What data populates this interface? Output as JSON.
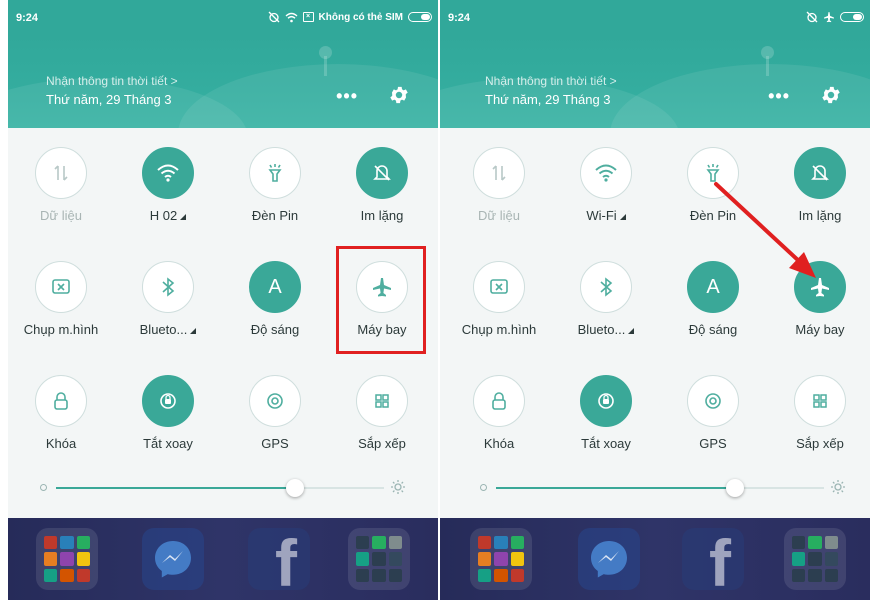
{
  "colors": {
    "accent": "#3aa898",
    "header": "#31a89a",
    "annotation_red": "#e02020"
  },
  "panels": [
    {
      "status": {
        "time": "9:24",
        "carrier": "Không có thẻ SIM"
      },
      "header": {
        "weather_link": "Nhận thông tin thời tiết >",
        "date": "Thứ năm, 29 Tháng 3"
      },
      "tiles": {
        "data": {
          "label": "Dữ liệu",
          "icon": "data-arrows-icon",
          "on": false
        },
        "wifi": {
          "label": "H 02",
          "icon": "wifi-icon",
          "on": true
        },
        "flashlight": {
          "label": "Đèn Pin",
          "icon": "flashlight-icon",
          "on": false
        },
        "silent": {
          "label": "Im lặng",
          "icon": "bell-off-icon",
          "on": true
        },
        "screenshot": {
          "label": "Chụp m.hình",
          "icon": "screenshot-icon",
          "on": false
        },
        "bluetooth": {
          "label": "Blueto...",
          "icon": "bluetooth-icon",
          "on": false
        },
        "brightness": {
          "label": "Độ sáng",
          "icon": "auto-brightness-icon",
          "glyph": "A",
          "on": true
        },
        "airplane": {
          "label": "Máy bay",
          "icon": "airplane-icon",
          "on": false
        },
        "lock": {
          "label": "Khóa",
          "icon": "lock-icon",
          "on": false
        },
        "rotate": {
          "label": "Tắt xoay",
          "icon": "rotate-lock-icon",
          "on": true
        },
        "gps": {
          "label": "GPS",
          "icon": "gps-icon",
          "on": false
        },
        "arrange": {
          "label": "Sắp xếp",
          "icon": "grid-icon",
          "on": false
        }
      },
      "brightness_level": 0.73
    },
    {
      "status": {
        "time": "9:24"
      },
      "header": {
        "weather_link": "Nhận thông tin thời tiết >",
        "date": "Thứ năm, 29 Tháng 3"
      },
      "tiles": {
        "data": {
          "label": "Dữ liệu",
          "icon": "data-arrows-icon",
          "on": false
        },
        "wifi": {
          "label": "Wi-Fi",
          "icon": "wifi-icon",
          "on": false
        },
        "flashlight": {
          "label": "Đèn Pin",
          "icon": "flashlight-icon",
          "on": false
        },
        "silent": {
          "label": "Im lặng",
          "icon": "bell-off-icon",
          "on": true
        },
        "screenshot": {
          "label": "Chụp m.hình",
          "icon": "screenshot-icon",
          "on": false
        },
        "bluetooth": {
          "label": "Blueto...",
          "icon": "bluetooth-icon",
          "on": false
        },
        "brightness": {
          "label": "Độ sáng",
          "icon": "auto-brightness-icon",
          "glyph": "A",
          "on": true
        },
        "airplane": {
          "label": "Máy bay",
          "icon": "airplane-icon",
          "on": true
        },
        "lock": {
          "label": "Khóa",
          "icon": "lock-icon",
          "on": false
        },
        "rotate": {
          "label": "Tắt xoay",
          "icon": "rotate-lock-icon",
          "on": true
        },
        "gps": {
          "label": "GPS",
          "icon": "gps-icon",
          "on": false
        },
        "arrange": {
          "label": "Sắp xếp",
          "icon": "grid-icon",
          "on": false
        }
      },
      "brightness_level": 0.73
    }
  ],
  "dock_apps": [
    "folder-icon",
    "messenger-icon",
    "facebook-icon",
    "folder-icon"
  ]
}
